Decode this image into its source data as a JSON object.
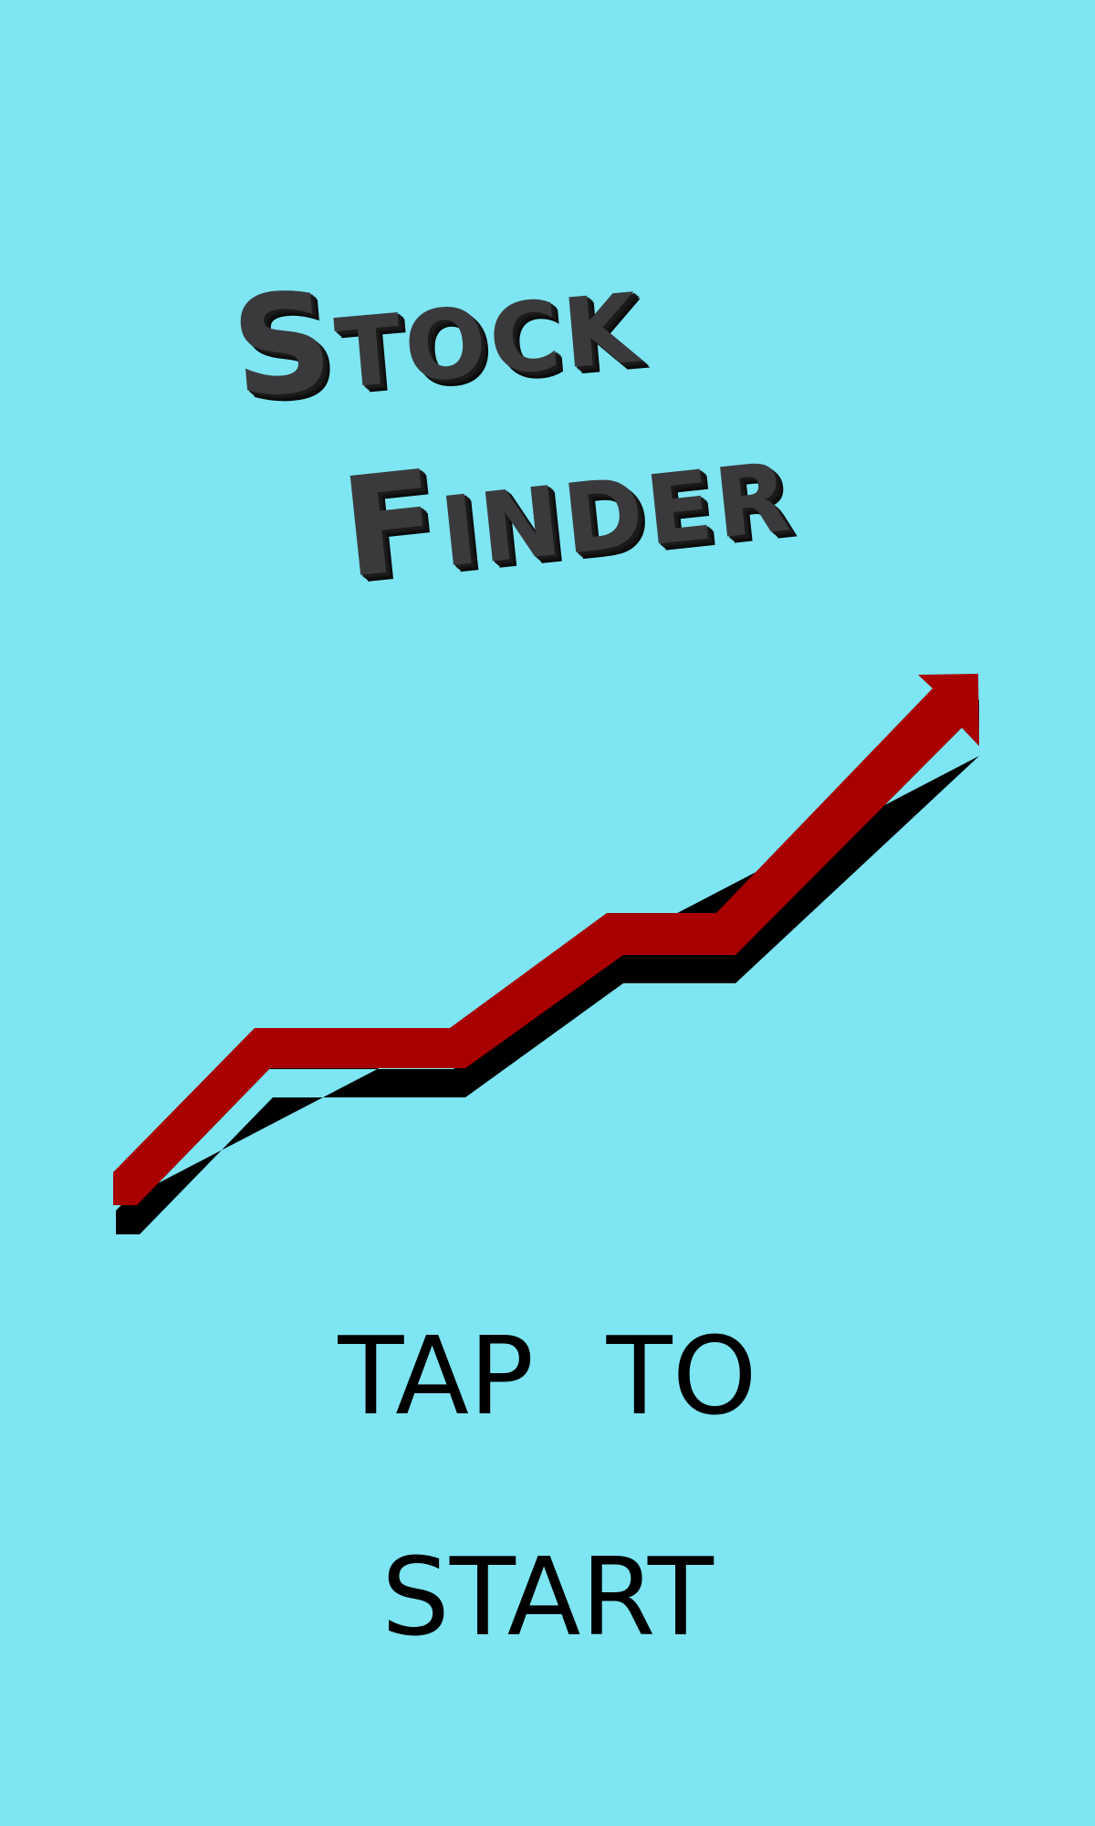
{
  "title": {
    "line1": "Stock",
    "line2": "Finder"
  },
  "prompt": {
    "line1": "TAP TO",
    "line2": "START"
  },
  "icons": {
    "trend_arrow": "trend-up-arrow-icon"
  },
  "colors": {
    "background": "#7ee5f2",
    "title_face": "#3a3a3c",
    "title_extrusion": "#141414",
    "arrow": "#a80000",
    "arrow_shadow": "#000000",
    "prompt_text": "#000000"
  }
}
